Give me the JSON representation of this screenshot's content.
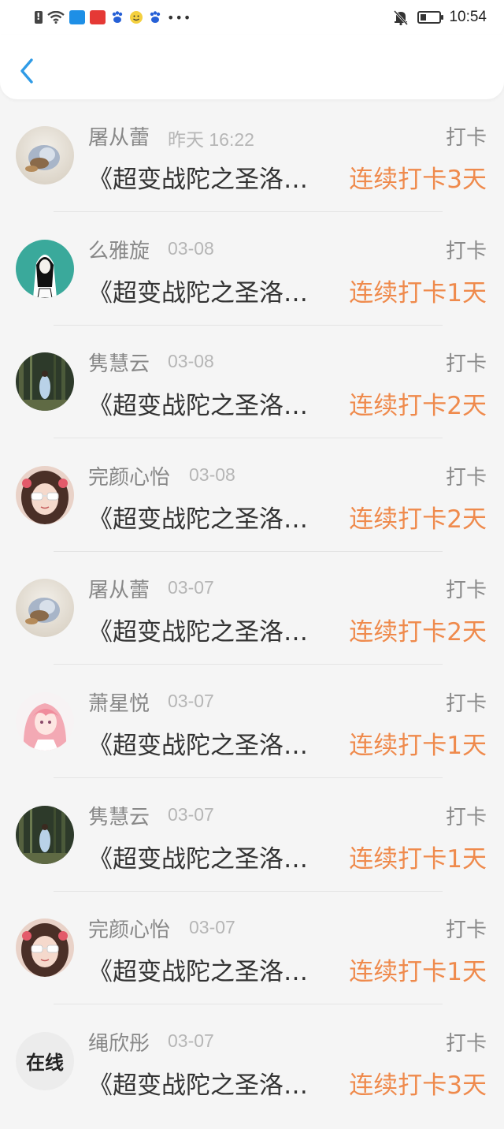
{
  "status_bar": {
    "time": "10:54",
    "icons": [
      "alert-icon",
      "wifi-icon",
      "app-icon-blue",
      "app-icon-red",
      "baidu-paw-icon",
      "smile-icon",
      "baidu-paw-icon",
      "more-dots-icon",
      "bell-off-icon",
      "battery-icon"
    ]
  },
  "nav": {
    "back_icon": "chevron-left-icon",
    "accent_color": "#2f9be6"
  },
  "colors": {
    "name": "#888888",
    "time": "#b6b6b6",
    "streak": "#ef8a4c",
    "title": "#333333"
  },
  "feed": [
    {
      "name": "屠从蕾",
      "time": "昨天 16:22",
      "action": "打卡",
      "title": "《超变战陀之圣洛斯》",
      "streak": "连续打卡3天",
      "avatar": "shell-photo"
    },
    {
      "name": "么雅旋",
      "time": "03-08",
      "action": "打卡",
      "title": "《超变战陀之圣洛斯》",
      "streak": "连续打卡1天",
      "avatar": "teal-sketch"
    },
    {
      "name": "隽慧云",
      "time": "03-08",
      "action": "打卡",
      "title": "《超变战陀之圣洛斯》",
      "streak": "连续打卡2天",
      "avatar": "forest-photo"
    },
    {
      "name": "完颜心怡",
      "time": "03-08",
      "action": "打卡",
      "title": "《超变战陀之圣洛斯》",
      "streak": "连续打卡2天",
      "avatar": "girl-glasses"
    },
    {
      "name": "屠从蕾",
      "time": "03-07",
      "action": "打卡",
      "title": "《超变战陀之圣洛斯》",
      "streak": "连续打卡2天",
      "avatar": "shell-photo"
    },
    {
      "name": "萧星悦",
      "time": "03-07",
      "action": "打卡",
      "title": "《超变战陀之圣洛斯》",
      "streak": "连续打卡1天",
      "avatar": "anime-pink"
    },
    {
      "name": "隽慧云",
      "time": "03-07",
      "action": "打卡",
      "title": "《超变战陀之圣洛斯》",
      "streak": "连续打卡1天",
      "avatar": "forest-photo"
    },
    {
      "name": "完颜心怡",
      "time": "03-07",
      "action": "打卡",
      "title": "《超变战陀之圣洛斯》",
      "streak": "连续打卡1天",
      "avatar": "girl-glasses"
    },
    {
      "name": "绳欣彤",
      "time": "03-07",
      "action": "打卡",
      "title": "《超变战陀之圣洛斯》",
      "streak": "连续打卡3天",
      "avatar": "text",
      "avatar_text": "在线"
    }
  ]
}
